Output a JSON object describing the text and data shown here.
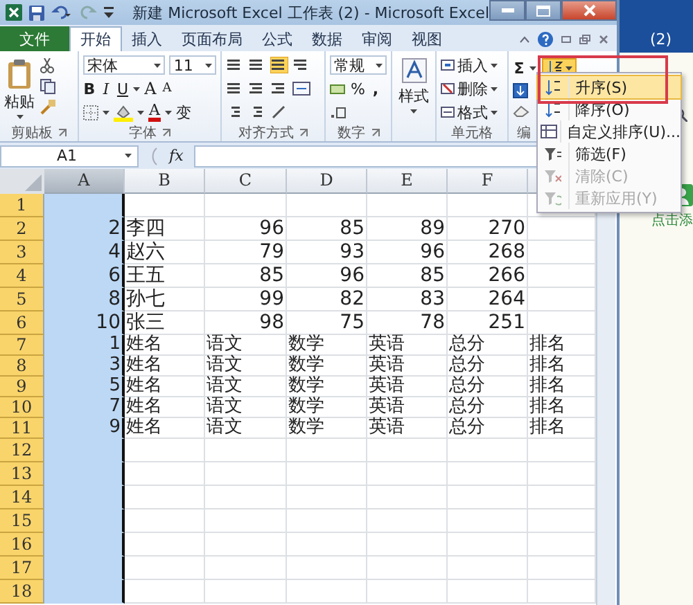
{
  "window": {
    "title": "新建 Microsoft Excel 工作表 (2) - Microsoft Excel"
  },
  "tabs": [
    {
      "label": "文件",
      "kind": "file",
      "selected": false
    },
    {
      "label": "开始",
      "kind": "tab",
      "selected": true
    },
    {
      "label": "插入",
      "kind": "tab",
      "selected": false
    },
    {
      "label": "页面布局",
      "kind": "tab",
      "selected": false
    },
    {
      "label": "公式",
      "kind": "tab",
      "selected": false
    },
    {
      "label": "数据",
      "kind": "tab",
      "selected": false
    },
    {
      "label": "审阅",
      "kind": "tab",
      "selected": false
    },
    {
      "label": "视图",
      "kind": "tab",
      "selected": false
    }
  ],
  "ribbon": {
    "groups": [
      {
        "kind": "clipboard",
        "label": "剪贴板",
        "paste": "粘贴"
      },
      {
        "kind": "font",
        "label": "字体",
        "font": "宋体",
        "size": "11",
        "bold": "B",
        "italic": "I",
        "underline": "U",
        "grow": "A",
        "shrink": "A",
        "font_color": "A",
        "phonetic": "变"
      },
      {
        "kind": "alignment",
        "label": "对齐方式"
      },
      {
        "kind": "number",
        "label": "数字",
        "format": "常规",
        "percent": "%",
        "comma": ","
      },
      {
        "kind": "styles",
        "button": "样式"
      },
      {
        "kind": "cells",
        "label": "单元格",
        "insert": "插入",
        "delete": "删除",
        "format": "格式"
      },
      {
        "kind": "editing",
        "label": "编",
        "sum": "Σ"
      }
    ]
  },
  "formula_bar": {
    "name_box": "A1",
    "fx": "fx"
  },
  "sheet": {
    "columns": [
      {
        "label": "A",
        "selected": true
      },
      {
        "label": "B",
        "selected": false
      },
      {
        "label": "C",
        "selected": false
      },
      {
        "label": "D",
        "selected": false
      },
      {
        "label": "E",
        "selected": false
      },
      {
        "label": "F",
        "selected": false
      }
    ],
    "rows": [
      {
        "number": "1",
        "kind": "empty",
        "cells": []
      },
      {
        "number": "2",
        "kind": "record",
        "cells": [
          "2",
          "李四",
          "96",
          "85",
          "89",
          "270"
        ]
      },
      {
        "number": "3",
        "kind": "record",
        "cells": [
          "4",
          "赵六",
          "79",
          "93",
          "96",
          "268"
        ]
      },
      {
        "number": "4",
        "kind": "record",
        "cells": [
          "6",
          "王五",
          "85",
          "96",
          "85",
          "266"
        ]
      },
      {
        "number": "5",
        "kind": "record",
        "cells": [
          "8",
          "孙七",
          "99",
          "82",
          "83",
          "264"
        ]
      },
      {
        "number": "6",
        "kind": "record",
        "cells": [
          "10",
          "张三",
          "98",
          "75",
          "78",
          "251"
        ]
      },
      {
        "number": "7",
        "kind": "label",
        "cells": [
          "1",
          "姓名",
          "语文",
          "数学",
          "英语",
          "总分",
          "排名"
        ]
      },
      {
        "number": "8",
        "kind": "label",
        "cells": [
          "3",
          "姓名",
          "语文",
          "数学",
          "英语",
          "总分",
          "排名"
        ]
      },
      {
        "number": "9",
        "kind": "label",
        "cells": [
          "5",
          "姓名",
          "语文",
          "数学",
          "英语",
          "总分",
          "排名"
        ]
      },
      {
        "number": "10",
        "kind": "label",
        "cells": [
          "7",
          "姓名",
          "语文",
          "数学",
          "英语",
          "总分",
          "排名"
        ]
      },
      {
        "number": "11",
        "kind": "label",
        "cells": [
          "9",
          "姓名",
          "语文",
          "数学",
          "英语",
          "总分",
          "排名"
        ]
      },
      {
        "number": "12",
        "kind": "empty",
        "cells": []
      },
      {
        "number": "13",
        "kind": "empty",
        "cells": []
      },
      {
        "number": "14",
        "kind": "empty",
        "cells": []
      },
      {
        "number": "15",
        "kind": "empty",
        "cells": []
      },
      {
        "number": "16",
        "kind": "empty",
        "cells": []
      },
      {
        "number": "17",
        "kind": "empty",
        "cells": []
      },
      {
        "number": "18",
        "kind": "empty",
        "cells": []
      }
    ]
  },
  "sort_menu": {
    "items": [
      {
        "label": "升序(S)",
        "selected": true,
        "disabled": false
      },
      {
        "label": "降序(O)",
        "selected": false,
        "disabled": false
      },
      {
        "label": "自定义排序(U)...",
        "selected": false,
        "disabled": false
      },
      {
        "label": "筛选(F)",
        "selected": false,
        "disabled": false
      },
      {
        "label": "清除(C)",
        "selected": false,
        "disabled": true
      },
      {
        "label": "重新应用(Y)",
        "selected": false,
        "disabled": true
      }
    ]
  },
  "side": {
    "badge": "(2)",
    "link": "点击添"
  }
}
